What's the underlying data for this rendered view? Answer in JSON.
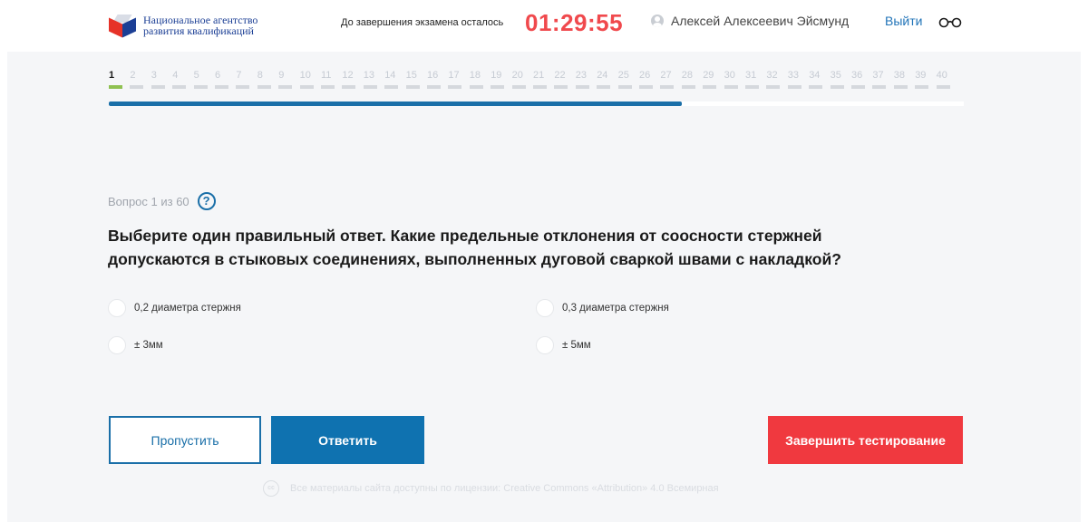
{
  "header": {
    "logo_line1": "Национальное агентство",
    "logo_line2": "развития квалификаций",
    "timer_label": "До завершения экзамена осталось",
    "timer_value": "01:29:55",
    "user_name": "Алексей Алексеевич Эйсмунд",
    "logout_label": "Выйти",
    "accessibility_icon": "glasses-icon",
    "user_icon": "user-avatar-icon"
  },
  "navigation": {
    "current_question": 1,
    "questions": [
      "1",
      "2",
      "3",
      "4",
      "5",
      "6",
      "7",
      "8",
      "9",
      "10",
      "11",
      "12",
      "13",
      "14",
      "15",
      "16",
      "17",
      "18",
      "19",
      "20",
      "21",
      "22",
      "23",
      "24",
      "25",
      "26",
      "27",
      "28",
      "29",
      "30",
      "31",
      "32",
      "33",
      "34",
      "35",
      "36",
      "37",
      "38",
      "39",
      "40"
    ],
    "time_progress": 0.67
  },
  "question": {
    "meta": "Вопрос 1 из 60",
    "help_icon": "question-mark-icon",
    "text": "Выберите один правильный ответ. Какие предельные отклонения от соосности стержней допускаются в стыковых соединениях, выполненных дуговой сваркой швами с накладкой?",
    "options": [
      {
        "label": "0,2 диаметра стержня"
      },
      {
        "label": "0,3 диаметра стержня"
      },
      {
        "label": "± 3мм"
      },
      {
        "label": "± 5мм"
      }
    ]
  },
  "actions": {
    "skip_label": "Пропустить",
    "answer_label": "Ответить",
    "finish_label": "Завершить тестирование"
  },
  "footer": {
    "cc_icon": "creative-commons-icon",
    "cc_text": "cc",
    "license_text": "Все материалы сайта доступны по лицензии: Creative Commons «Attribution» 4.0 Всемирная"
  },
  "colors": {
    "accent": "#1a6fa8",
    "timer": "#f0494d",
    "finish": "#f0393f",
    "active_question": "#8fc151",
    "background": "#f5f6f8"
  }
}
